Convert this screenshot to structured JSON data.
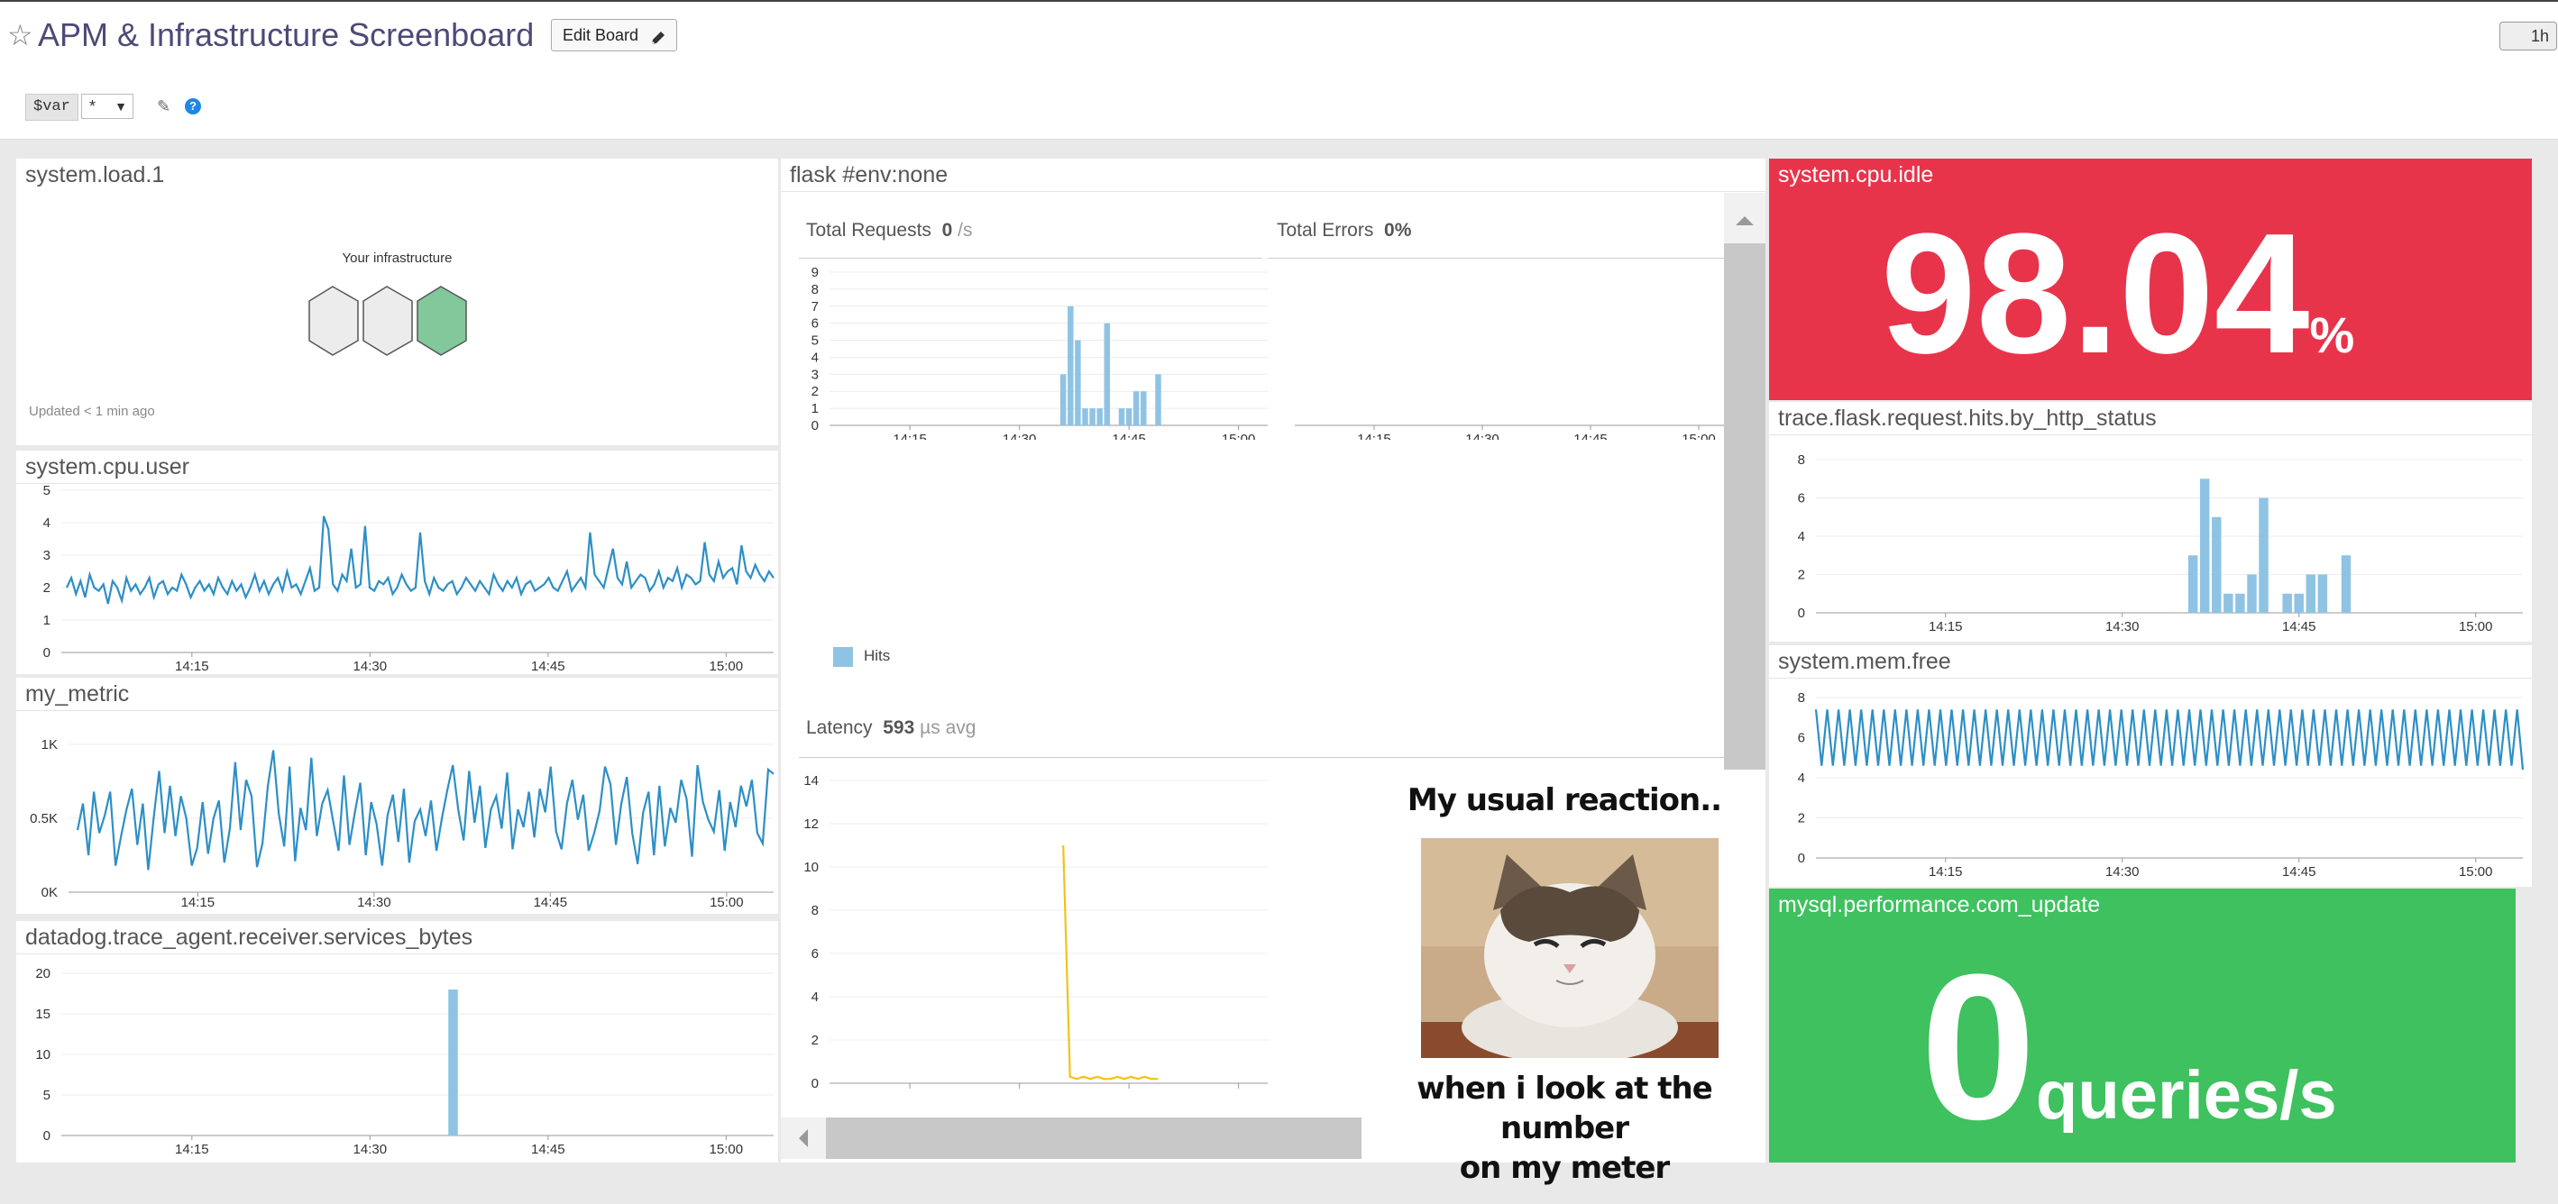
{
  "header": {
    "title": "APM & Infrastructure Screenboard",
    "edit_label": "Edit Board",
    "timeframe": "1h"
  },
  "template_vars": {
    "var_name": "$var",
    "var_value": "*"
  },
  "widgets": {
    "load": {
      "title": "system.load.1",
      "map_label": "Your infrastructure",
      "updated": "Updated < 1 min ago"
    },
    "cpu_user": {
      "title": "system.cpu.user"
    },
    "my_metric": {
      "title": "my_metric"
    },
    "services_bytes": {
      "title": "datadog.trace_agent.receiver.services_bytes"
    },
    "flask": {
      "title": "flask #env:none",
      "requests_label": "Total Requests",
      "requests_value": "0",
      "requests_unit": "/s",
      "errors_label": "Total Errors",
      "errors_value": "0%",
      "legend_hits": "Hits",
      "latency_label": "Latency",
      "latency_value": "593",
      "latency_unit": "µs",
      "latency_agg": "avg"
    },
    "cpu_idle": {
      "title": "system.cpu.idle",
      "value": "98.04",
      "unit": "%",
      "bg": "#e8344b"
    },
    "hits_status": {
      "title": "trace.flask.request.hits.by_http_status"
    },
    "mem_free": {
      "title": "system.mem.free"
    },
    "com_update": {
      "title": "mysql.performance.com_update",
      "value": "0",
      "unit": "queries/s",
      "bg": "#3ec15e"
    },
    "meme": {
      "top": "My usual reaction..",
      "bottom_line1": "when i look at the number",
      "bottom_line2": "on my meter"
    }
  },
  "colors": {
    "line": "#2d8fc6",
    "bar": "#8fc3e4",
    "latency": "#f2c21b",
    "host_ok": "#82c89a"
  },
  "chart_data": [
    {
      "id": "cpu_user",
      "type": "line",
      "title": "system.cpu.user",
      "x_ticks": [
        "14:15",
        "14:30",
        "14:45",
        "15:00"
      ],
      "ylim": [
        0,
        5
      ],
      "y_ticks": [
        "0",
        "1",
        "2",
        "3",
        "4",
        "5"
      ],
      "series": [
        {
          "values": [
            2.0,
            2.3,
            1.8,
            2.2,
            1.7,
            2.4,
            2.0,
            1.9,
            2.1,
            1.5,
            2.2,
            2.0,
            1.6,
            2.3,
            1.9,
            2.1,
            1.8,
            2.0,
            2.3,
            1.7,
            2.1,
            2.2,
            1.8,
            2.0,
            1.9,
            2.4,
            2.1,
            1.7,
            2.0,
            2.2,
            1.9,
            2.1,
            1.8,
            2.3,
            2.0,
            1.8,
            2.2,
            1.9,
            2.1,
            1.7,
            2.0,
            2.4,
            1.9,
            2.2,
            1.8,
            2.1,
            2.3,
            1.9,
            2.5,
            2.0,
            2.1,
            1.8,
            2.2,
            2.6,
            1.9,
            2.0,
            4.2,
            3.8,
            2.1,
            1.9,
            2.4,
            2.2,
            3.2,
            2.0,
            2.1,
            3.9,
            2.0,
            1.9,
            2.2,
            2.1,
            2.3,
            1.8,
            2.0,
            2.4,
            2.1,
            1.9,
            2.0,
            3.7,
            2.2,
            1.8,
            2.3,
            2.0,
            1.9,
            2.1,
            2.2,
            1.8,
            2.0,
            2.3,
            2.1,
            1.9,
            2.2,
            2.0,
            1.8,
            2.4,
            2.1,
            1.9,
            2.2,
            2.0,
            2.3,
            1.8,
            2.1,
            2.2,
            1.9,
            2.0,
            2.1,
            2.3,
            2.0,
            1.9,
            2.2,
            2.5,
            1.9,
            2.1,
            2.3,
            2.0,
            3.7,
            2.4,
            2.2,
            2.0,
            2.6,
            3.2,
            2.3,
            2.1,
            2.8,
            2.0,
            2.2,
            2.4,
            2.3,
            1.9,
            2.1,
            2.5,
            2.0,
            2.3,
            2.2,
            2.6,
            2.0,
            2.4,
            2.3,
            2.1,
            2.2,
            3.4,
            2.4,
            2.2,
            2.8,
            2.3,
            2.5,
            2.6,
            2.1,
            3.3,
            2.5,
            2.3,
            2.7,
            2.4,
            2.2,
            2.5,
            2.3
          ]
        }
      ]
    },
    {
      "id": "my_metric",
      "type": "line",
      "title": "my_metric",
      "x_ticks": [
        "14:15",
        "14:30",
        "14:45",
        "15:00"
      ],
      "ylim": [
        0,
        1000
      ],
      "y_ticks": [
        "0K",
        "0.5K",
        "1K"
      ],
      "series": [
        {
          "values": [
            420,
            600,
            250,
            680,
            400,
            520,
            680,
            180,
            380,
            560,
            700,
            320,
            600,
            150,
            500,
            820,
            400,
            720,
            380,
            650,
            500,
            180,
            300,
            610,
            260,
            500,
            620,
            200,
            430,
            880,
            420,
            760,
            650,
            170,
            330,
            720,
            960,
            530,
            310,
            850,
            210,
            570,
            420,
            910,
            380,
            600,
            690,
            480,
            280,
            790,
            320,
            540,
            740,
            250,
            610,
            460,
            180,
            520,
            660,
            340,
            700,
            200,
            480,
            560,
            380,
            620,
            280,
            500,
            690,
            860,
            560,
            350,
            820,
            470,
            720,
            300,
            560,
            650,
            430,
            810,
            290,
            560,
            440,
            680,
            370,
            700,
            540,
            850,
            410,
            290,
            600,
            760,
            490,
            660,
            280,
            400,
            550,
            850,
            730,
            320,
            600,
            780,
            400,
            190,
            540,
            680,
            250,
            720,
            310,
            570,
            470,
            760,
            630,
            240,
            860,
            610,
            490,
            410,
            690,
            280,
            610,
            440,
            720,
            580,
            760,
            400,
            330,
            830,
            800
          ]
        }
      ]
    },
    {
      "id": "services_bytes",
      "type": "bar",
      "title": "datadog.trace_agent.receiver.services_bytes",
      "x_ticks": [
        "14:15",
        "14:30",
        "14:45",
        "15:00"
      ],
      "ylim": [
        0,
        20
      ],
      "y_ticks": [
        "0",
        "5",
        "10",
        "15",
        "20"
      ],
      "bars": [
        {
          "t": "14:37",
          "value": 18
        }
      ]
    },
    {
      "id": "flask_requests",
      "type": "bar",
      "title": "Total Requests",
      "x_ticks": [
        "14:15",
        "14:30",
        "14:45",
        "15:00"
      ],
      "ylim": [
        0,
        9
      ],
      "y_ticks": [
        "0",
        "1",
        "2",
        "3",
        "4",
        "5",
        "6",
        "7",
        "8",
        "9"
      ],
      "legend": [
        "Hits"
      ],
      "bars": [
        {
          "t": "14:36",
          "value": 3
        },
        {
          "t": "14:37",
          "value": 7
        },
        {
          "t": "14:38",
          "value": 5
        },
        {
          "t": "14:39",
          "value": 1
        },
        {
          "t": "14:40",
          "value": 1
        },
        {
          "t": "14:41",
          "value": 1
        },
        {
          "t": "14:42",
          "value": 6
        },
        {
          "t": "14:43",
          "value": 0
        },
        {
          "t": "14:44",
          "value": 1
        },
        {
          "t": "14:45",
          "value": 1
        },
        {
          "t": "14:46",
          "value": 2
        },
        {
          "t": "14:47",
          "value": 2
        },
        {
          "t": "14:48",
          "value": 0
        },
        {
          "t": "14:49",
          "value": 3
        }
      ]
    },
    {
      "id": "flask_errors",
      "type": "bar",
      "title": "Total Errors",
      "x_ticks": [
        "14:15",
        "14:30",
        "14:45",
        "15:00"
      ],
      "bars": []
    },
    {
      "id": "flask_latency",
      "type": "line",
      "title": "Latency",
      "x_ticks": [],
      "ylim": [
        0,
        14
      ],
      "y_ticks": [
        "0",
        "2",
        "4",
        "6",
        "8",
        "10",
        "12",
        "14"
      ],
      "series": [
        {
          "values": [
            11.0,
            0.3,
            0.2,
            0.3,
            0.2,
            0.3,
            0.2,
            0.2,
            0.3,
            0.2,
            0.3,
            0.2,
            0.3,
            0.2,
            0.2
          ]
        }
      ]
    },
    {
      "id": "hits_status",
      "type": "bar",
      "title": "trace.flask.request.hits.by_http_status",
      "x_ticks": [
        "14:15",
        "14:30",
        "14:45",
        "15:00"
      ],
      "ylim": [
        0,
        8
      ],
      "y_ticks": [
        "0",
        "2",
        "4",
        "6",
        "8"
      ],
      "bars": [
        {
          "t": "14:36",
          "value": 3
        },
        {
          "t": "14:37",
          "value": 7
        },
        {
          "t": "14:38",
          "value": 5
        },
        {
          "t": "14:39",
          "value": 1
        },
        {
          "t": "14:40",
          "value": 1
        },
        {
          "t": "14:41",
          "value": 2
        },
        {
          "t": "14:42",
          "value": 6
        },
        {
          "t": "14:43",
          "value": 0
        },
        {
          "t": "14:44",
          "value": 1
        },
        {
          "t": "14:45",
          "value": 1
        },
        {
          "t": "14:46",
          "value": 2
        },
        {
          "t": "14:47",
          "value": 2
        },
        {
          "t": "14:48",
          "value": 0
        },
        {
          "t": "14:49",
          "value": 3
        }
      ]
    },
    {
      "id": "mem_free",
      "type": "line",
      "title": "system.mem.free",
      "x_ticks": [
        "14:15",
        "14:30",
        "14:45",
        "15:00"
      ],
      "ylim": [
        0,
        8
      ],
      "y_ticks": [
        "0",
        "2",
        "4",
        "6",
        "8"
      ],
      "series": [
        {
          "values": [
            7.4,
            4.6,
            7.4,
            4.6,
            7.4,
            4.6,
            7.4,
            4.6,
            7.4,
            4.6,
            7.4,
            4.6,
            7.4,
            4.6,
            7.4,
            4.6,
            7.4,
            4.6,
            7.4,
            4.6,
            7.4,
            4.6,
            7.4,
            4.6,
            7.4,
            4.6,
            7.4,
            4.6,
            7.4,
            4.6,
            7.4,
            4.6,
            7.4,
            4.6,
            7.4,
            4.6,
            7.4,
            4.6,
            7.4,
            4.6,
            7.4,
            4.6,
            7.4,
            4.6,
            7.4,
            4.6,
            7.4,
            4.6,
            7.4,
            4.6,
            7.4,
            4.6,
            7.4,
            4.6,
            7.4,
            4.6,
            7.4,
            4.6,
            7.4,
            4.6,
            7.4,
            4.6,
            7.4,
            4.6,
            7.4,
            4.6,
            7.4,
            4.6,
            7.4,
            4.6,
            7.4,
            4.6,
            7.4,
            4.6,
            7.4,
            4.6,
            7.4,
            4.6,
            7.4,
            4.6,
            7.4,
            4.6,
            7.4,
            4.6,
            7.4,
            4.6,
            7.4,
            4.6,
            7.4,
            4.6,
            7.4,
            4.6,
            7.4,
            4.6,
            7.4,
            4.6,
            7.4,
            4.6,
            7.4,
            4.6,
            7.4,
            4.6,
            7.4,
            4.6,
            7.4,
            4.6,
            7.4,
            4.6,
            7.4,
            4.6,
            7.4,
            4.6,
            7.4,
            4.6,
            7.4,
            4.6,
            7.4,
            4.6,
            7.4,
            4.6,
            7.4,
            4.6,
            7.4,
            4.6,
            7.4,
            4.4
          ]
        }
      ]
    }
  ]
}
